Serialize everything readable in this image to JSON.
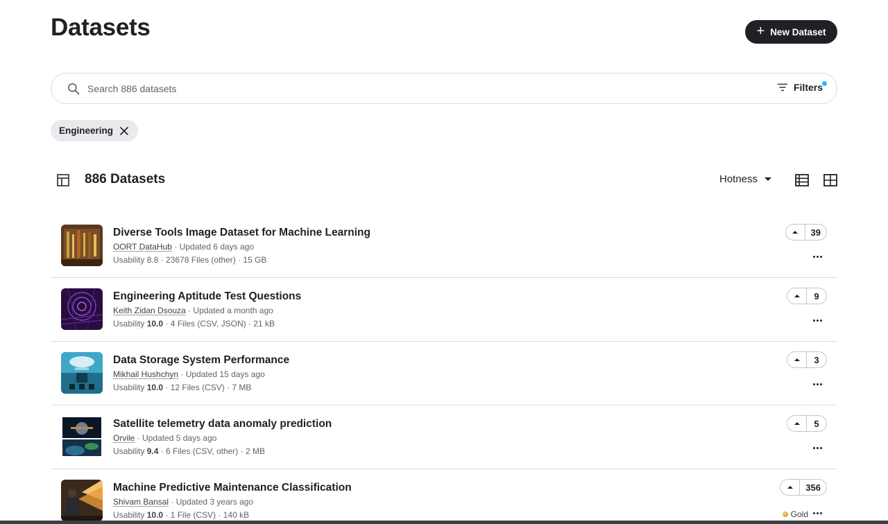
{
  "header": {
    "title": "Datasets",
    "new_button_label": "New Dataset"
  },
  "search": {
    "placeholder": "Search 886 datasets",
    "value": "",
    "filters_label": "Filters"
  },
  "active_filter": {
    "label": "Engineering"
  },
  "results": {
    "count_label": "886 Datasets",
    "sort_label": "Hotness"
  },
  "datasets": [
    {
      "title": "Diverse Tools Image Dataset for Machine Learning",
      "owner": "OORT DataHub",
      "updated": " · Updated 6 days ago",
      "usability_label": "Usability ",
      "usability": "8.8",
      "details": " · 23678 Files (other) · 15 GB",
      "votes": "39",
      "medal": ""
    },
    {
      "title": "Engineering Aptitude Test Questions",
      "owner": "Keith Zidan Dsouza",
      "updated": " · Updated a month ago",
      "usability_label": "Usability ",
      "usability": "10.0",
      "details": " · 4 Files (CSV, JSON) · 21 kB",
      "votes": "9",
      "medal": ""
    },
    {
      "title": "Data Storage System Performance",
      "owner": "Mikhail Hushchyn",
      "updated": " · Updated 15 days ago",
      "usability_label": "Usability ",
      "usability": "10.0",
      "details": " · 12 Files (CSV) · 7 MB",
      "votes": "3",
      "medal": ""
    },
    {
      "title": "Satellite telemetry data anomaly prediction",
      "owner": "Orvile",
      "updated": " · Updated 5 days ago",
      "usability_label": "Usability ",
      "usability": "9.4",
      "details": " · 6 Files (CSV, other) · 2 MB",
      "votes": "5",
      "medal": ""
    },
    {
      "title": "Machine Predictive Maintenance Classification",
      "owner": "Shivam Bansal",
      "updated": " · Updated 3 years ago",
      "usability_label": "Usability ",
      "usability": "10.0",
      "details": " · 1 File (CSV) · 140 kB",
      "votes": "356",
      "medal": "Gold"
    }
  ],
  "colors": {
    "primary_button": "#202124",
    "filter_dot": "#20beff",
    "chip_bg": "#e8eaed",
    "border": "#dadce0",
    "gold": "#d4a52a"
  },
  "icons": {
    "search": "search-icon",
    "filters": "filter-lines-icon",
    "chip_close": "close-icon",
    "count": "table-icon",
    "sort": "caret-down-icon",
    "view_list": "list-view-icon",
    "view_grid": "grid-view-icon",
    "upvote": "caret-up-icon",
    "more": "more-horizontal-icon"
  }
}
